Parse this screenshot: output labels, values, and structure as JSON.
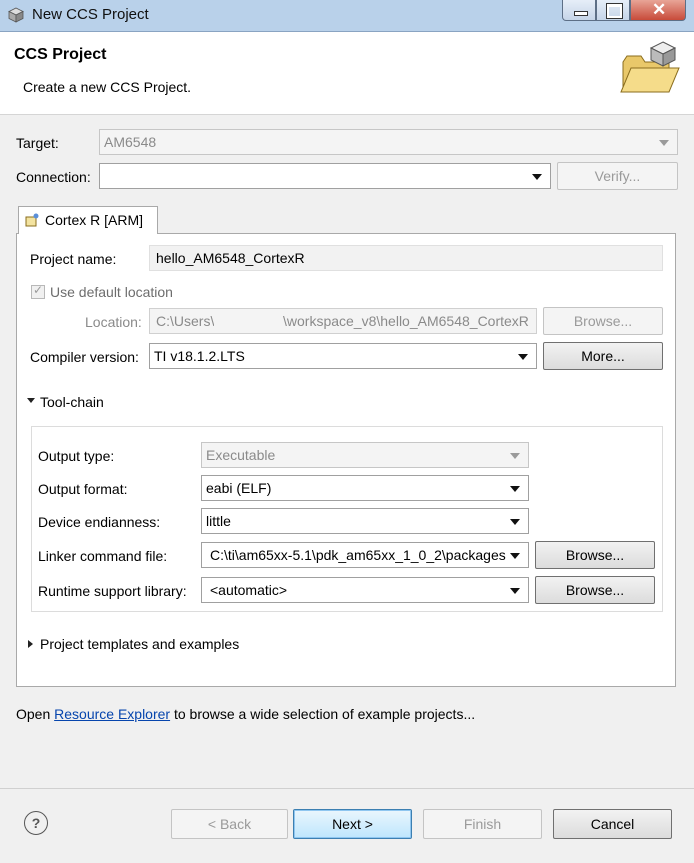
{
  "window": {
    "title": "New CCS Project"
  },
  "header": {
    "title": "CCS Project",
    "description": "Create a new CCS Project."
  },
  "target": {
    "label": "Target:",
    "value": "AM6548"
  },
  "connection": {
    "label": "Connection:",
    "value": "",
    "verify_label": "Verify..."
  },
  "tab": {
    "label": "Cortex R [ARM]"
  },
  "project": {
    "name_label": "Project name:",
    "name_value": "hello_AM6548_CortexR",
    "use_default_label": "Use default location",
    "location_label": "Location:",
    "location_value_prefix": "C:\\Users\\",
    "location_value_suffix": "\\workspace_v8\\hello_AM6548_CortexR",
    "location_browse_label": "Browse...",
    "compiler_label": "Compiler version:",
    "compiler_value": "TI v18.1.2.LTS",
    "more_label": "More..."
  },
  "toolchain": {
    "section_label": "Tool-chain",
    "output_type_label": "Output type:",
    "output_type_value": "Executable",
    "output_format_label": "Output format:",
    "output_format_value": "eabi (ELF)",
    "endianness_label": "Device endianness:",
    "endianness_value": "little",
    "linker_label": "Linker command file:",
    "linker_value": "C:\\ti\\am65xx-5.1\\pdk_am65xx_1_0_2\\packages",
    "runtime_label": "Runtime support library:",
    "runtime_value": "<automatic>",
    "browse_label": "Browse..."
  },
  "templates": {
    "section_label": "Project templates and examples"
  },
  "resource": {
    "prefix": "Open ",
    "link": "Resource Explorer",
    "suffix": " to browse a wide selection of example projects..."
  },
  "footer": {
    "back": "< Back",
    "next": "Next >",
    "finish": "Finish",
    "cancel": "Cancel",
    "help": "?"
  }
}
